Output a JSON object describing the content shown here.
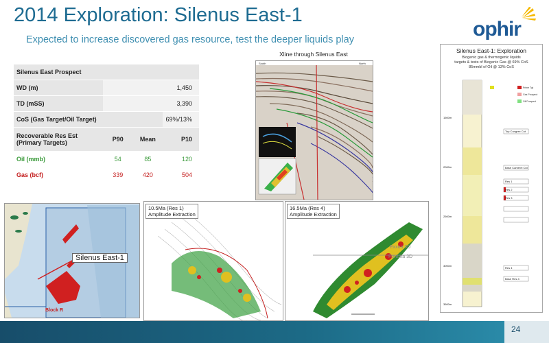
{
  "title": "2014 Exploration: Silenus East-1",
  "subtitle": "Expected to increase discovered gas resource, test the deeper liquids play",
  "logo": {
    "text": "ophir"
  },
  "table": {
    "header": "Silenus East Prospect",
    "rows": [
      {
        "label": "WD (m)",
        "value": "1,450"
      },
      {
        "label": "TD (mSS)",
        "value": "3,390"
      },
      {
        "label": "CoS (Gas Target/Oil Target)",
        "value": "69%/13%"
      }
    ],
    "res_header": {
      "label": "Recoverable Res Est (Primary Targets)",
      "p90": "P90",
      "mean": "Mean",
      "p10": "P10"
    },
    "oil": {
      "label": "Oil (mmb)",
      "p90": "54",
      "mean": "85",
      "p10": "120"
    },
    "gas": {
      "label": "Gas (bcf)",
      "p90": "339",
      "mean": "420",
      "p10": "504"
    }
  },
  "seismic": {
    "title": "Xline through Silenus East",
    "south": "South",
    "north": "North"
  },
  "map": {
    "callout": "Silenus East-1",
    "block": "Block R"
  },
  "amp1": {
    "line1": "10.5Ma (Res 1)",
    "line2": "Amplitude Extraction"
  },
  "amp2": {
    "line1": "16.5Ma (Res 4)",
    "line2": "Amplitude Extraction",
    "exxon": "Exxon 3D",
    "fortuna": "Fortuna 3D"
  },
  "strat": {
    "title": "Silenus East-1:  Exploration",
    "line1": "Biogenic gas & thermogenic liquids",
    "line2": "targets & tests of Biogenic Gas @ 69% CoS",
    "line3": "85mmbl of Oil @ 13% CoS",
    "legend": [
      "Prime Tgt",
      "Gas Prospect",
      "Oil Prospect"
    ],
    "depths": [
      "1500m",
      "2000m",
      "2500m",
      "3000m",
      "3500m"
    ],
    "labels": [
      "Top Congrex Cut",
      "Base Camerel Cut",
      "Res 1",
      "Res 2",
      "Res 3",
      "Res 4",
      "Base Res 4"
    ]
  },
  "page_number": "24",
  "colors": {
    "title": "#1d6b91",
    "oil": "#3a9a3a",
    "gas": "#c41e1e",
    "footer": "#154a66"
  }
}
